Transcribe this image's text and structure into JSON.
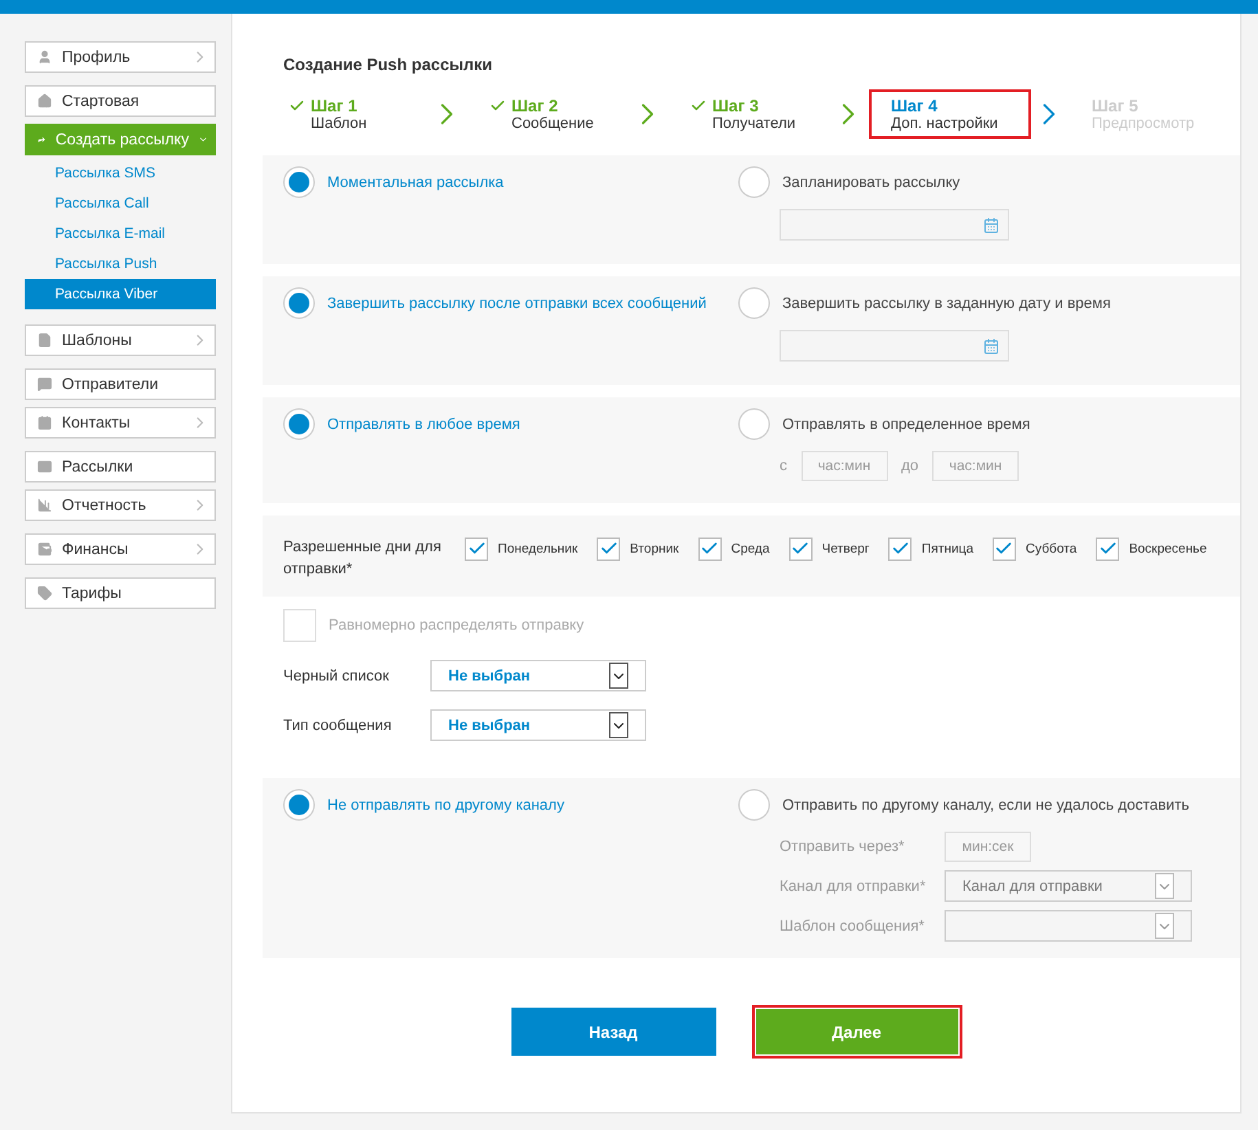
{
  "sidebar": {
    "groups": [
      [
        {
          "label": "Профиль",
          "chevron": true
        }
      ],
      [
        {
          "label": "Стартовая",
          "chevron": false
        },
        {
          "label": "Создать рассылку",
          "chevron": true,
          "expanded": true,
          "children": [
            {
              "label": "Рассылка SMS",
              "selected": false
            },
            {
              "label": "Рассылка Call",
              "selected": false
            },
            {
              "label": "Рассылка E-mail",
              "selected": false
            },
            {
              "label": "Рассылка Push",
              "selected": false
            },
            {
              "label": "Рассылка Viber",
              "selected": true
            }
          ]
        }
      ],
      [
        {
          "label": "Шаблоны",
          "chevron": true
        }
      ],
      [
        {
          "label": "Отправители",
          "chevron": false
        },
        {
          "label": "Контакты",
          "chevron": true
        }
      ],
      [
        {
          "label": "Рассылки",
          "chevron": false
        },
        {
          "label": "Отчетность",
          "chevron": true
        }
      ],
      [
        {
          "label": "Финансы",
          "chevron": true
        }
      ],
      [
        {
          "label": "Тарифы",
          "chevron": false
        }
      ]
    ]
  },
  "title": "Создание Push рассылки",
  "steps": [
    {
      "label": "Шаг 1",
      "sub": "Шаблон",
      "done": true,
      "current": false,
      "highlighted": false
    },
    {
      "label": "Шаг 2",
      "sub": "Сообщение",
      "done": true,
      "current": false,
      "highlighted": false
    },
    {
      "label": "Шаг 3",
      "sub": "Получатели",
      "done": true,
      "current": false,
      "highlighted": false
    },
    {
      "label": "Шаг 4",
      "sub": "Доп. настройки",
      "done": false,
      "current": true,
      "highlighted": true
    },
    {
      "label": "Шаг 5",
      "sub": "Предпросмотр",
      "done": false,
      "current": false,
      "highlighted": false
    }
  ],
  "sections": [
    {
      "kind": "choice",
      "options": [
        {
          "label": "Моментальная рассылка",
          "selected": true
        },
        {
          "label": "Запланировать рассылку",
          "selected": false,
          "fields": [
            {
              "kind": "date"
            }
          ]
        }
      ]
    },
    {
      "kind": "choice",
      "options": [
        {
          "label": "Завершить рассылку после отправки всех сообщений",
          "selected": true
        },
        {
          "label": "Завершить рассылку в заданную дату и время",
          "selected": false,
          "fields": [
            {
              "kind": "date"
            }
          ]
        }
      ]
    },
    {
      "kind": "choice",
      "options": [
        {
          "label": "Отправлять в любое время",
          "selected": true
        },
        {
          "label": "Отправлять в определенное время",
          "selected": false,
          "fields": [
            {
              "kind": "time-range",
              "from": "с",
              "to": "до",
              "placeholder_from": "час:мин",
              "placeholder_to": "час:мин"
            }
          ]
        }
      ]
    },
    {
      "kind": "days",
      "label": "Разрешенные дни для отправки*",
      "days": [
        {
          "label": "Понедельник",
          "checked": true
        },
        {
          "label": "Вторник",
          "checked": true
        },
        {
          "label": "Среда",
          "checked": true
        },
        {
          "label": "Четверг",
          "checked": true
        },
        {
          "label": "Пятница",
          "checked": true
        },
        {
          "label": "Суббота",
          "checked": true
        },
        {
          "label": "Воскресенье",
          "checked": true
        }
      ]
    },
    {
      "kind": "plain",
      "checkbox": {
        "label": "Равномерно распределять отправку",
        "checked": false,
        "disabled": true
      },
      "selects": [
        {
          "label": "Черный список",
          "value": "Не выбран"
        },
        {
          "label": "Тип сообщения",
          "value": "Не выбран"
        }
      ]
    },
    {
      "kind": "choice",
      "options": [
        {
          "label": "Не отправлять по другому каналу",
          "selected": true
        },
        {
          "label": "Отправить по другому каналу, если не удалось доставить",
          "selected": false,
          "fields": [
            {
              "kind": "labeled-input",
              "label": "Отправить через*",
              "placeholder": "мин:сек"
            },
            {
              "kind": "labeled-select",
              "label": "Канал для отправки*",
              "value": "Канал для отправки"
            },
            {
              "kind": "labeled-select",
              "label": "Шаблон сообщения*"
            }
          ]
        }
      ]
    }
  ],
  "buttons": [
    {
      "label": "Назад",
      "kind": "back",
      "highlighted": false
    },
    {
      "label": "Далее",
      "kind": "next",
      "highlighted": true
    }
  ]
}
